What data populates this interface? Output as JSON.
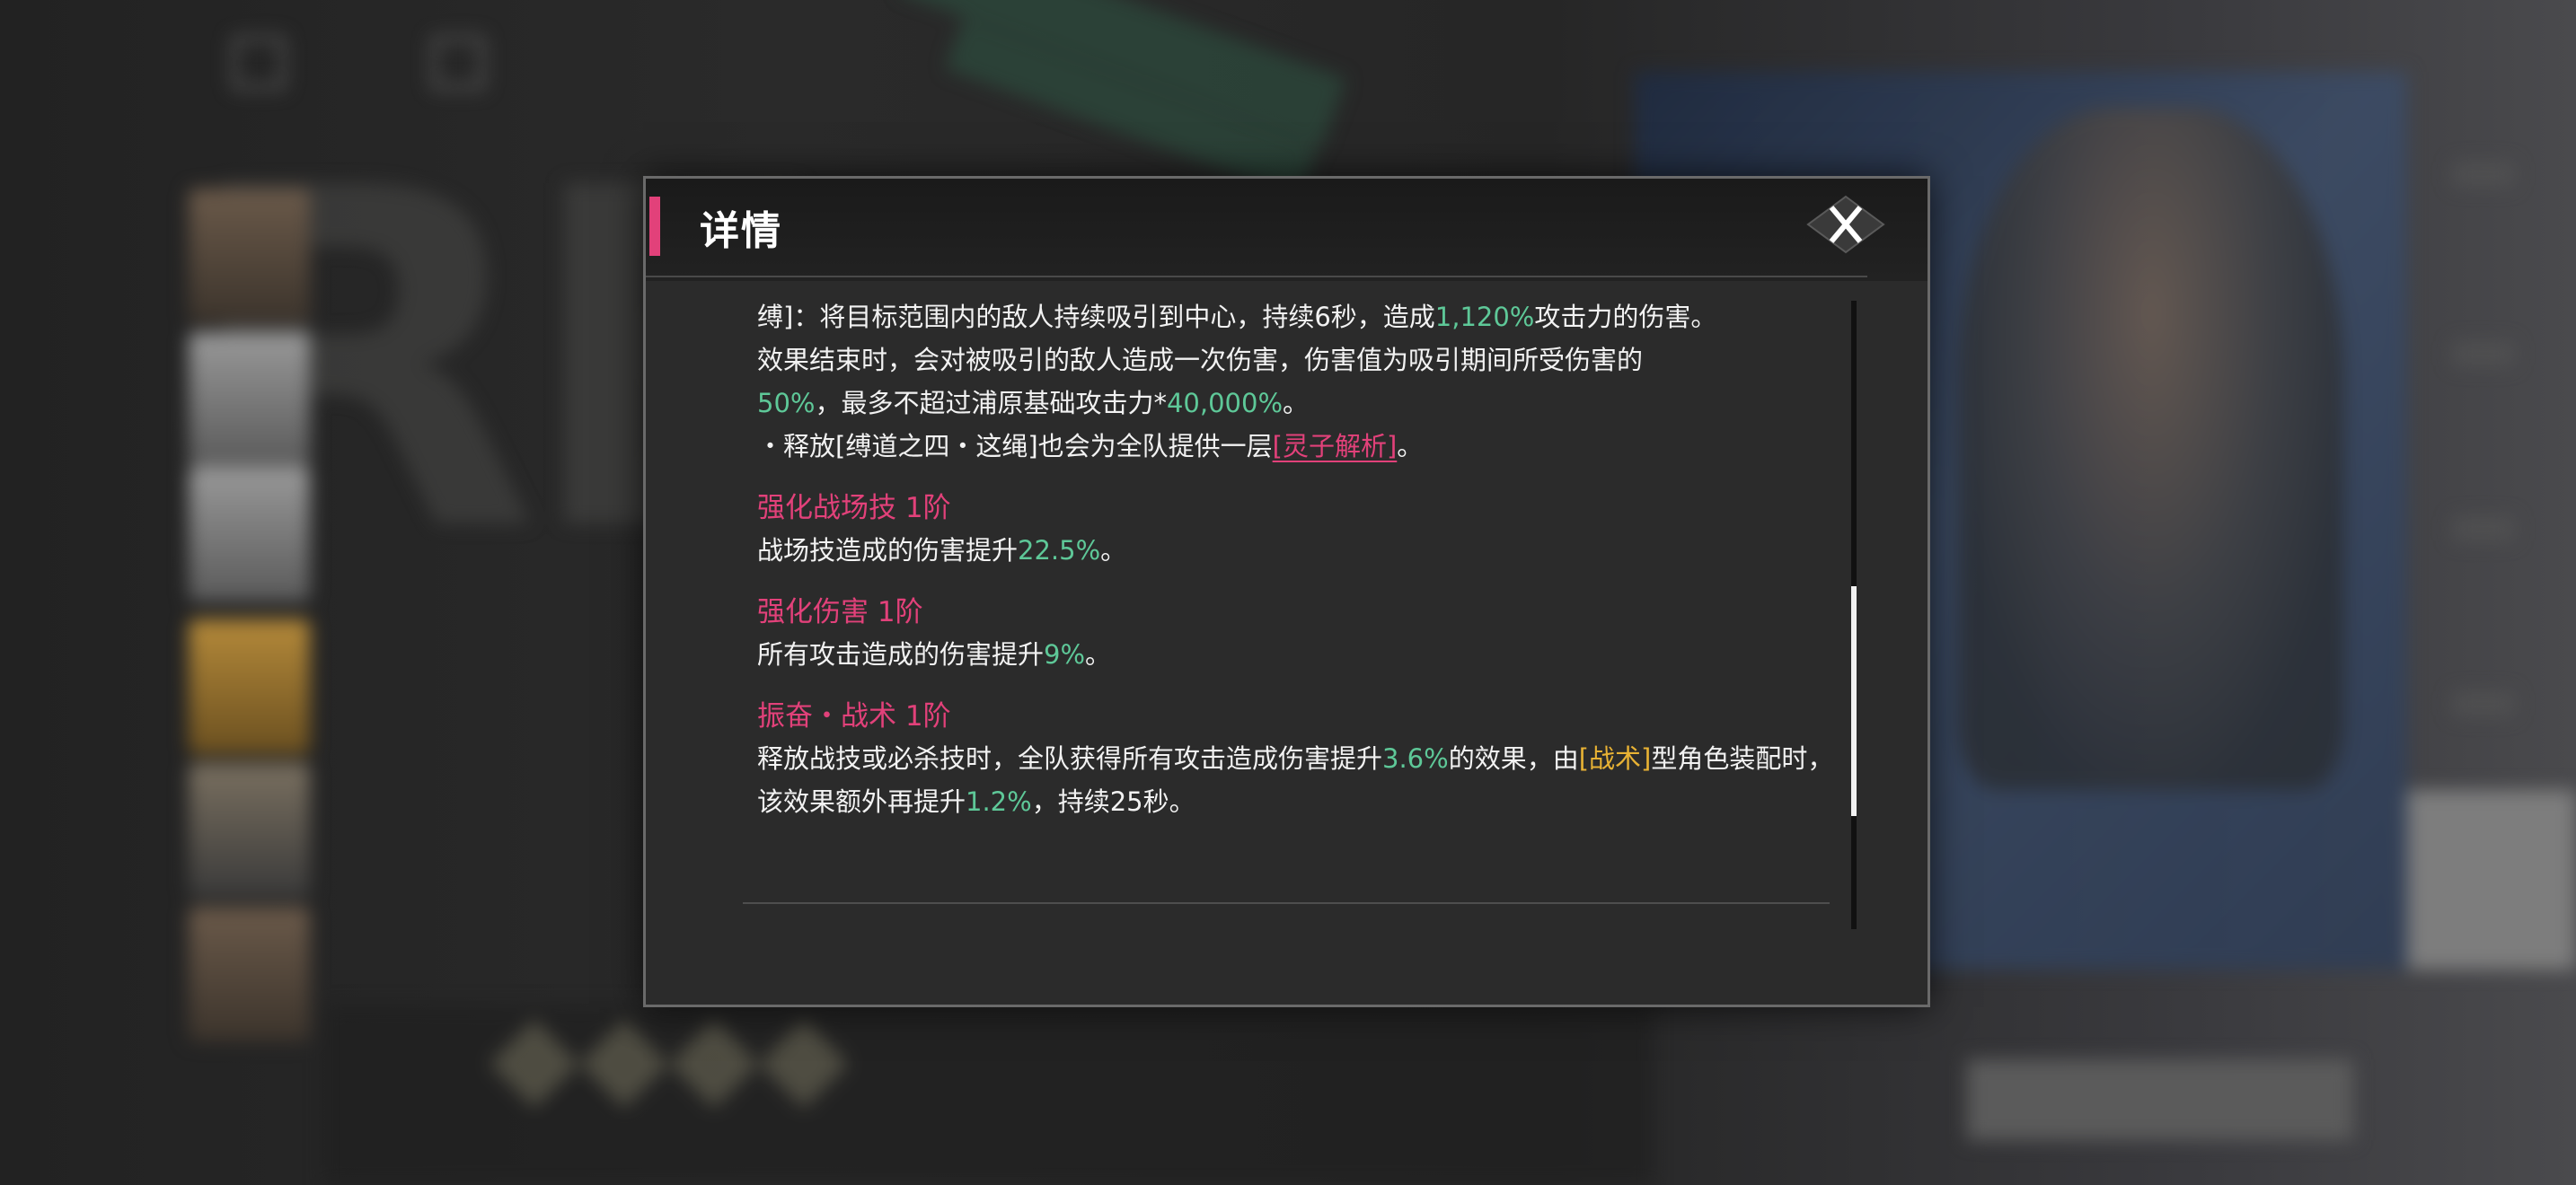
{
  "dialog": {
    "title": "详情",
    "close_icon": "close-x-icon",
    "accent_color": "#e2417a"
  },
  "content": {
    "intro": {
      "line1_pre": "缚]：将目标范围内的敌人持续吸引到中心，持续6秒，造成",
      "line1_value": "1,120%",
      "line1_post": "攻击力的伤害。",
      "line2": "效果结束时，会对被吸引的敌人造成一次伤害，伤害值为吸引期间所受伤害的",
      "line3_value1": "50%",
      "line3_mid": "，最多不超过浦原基础攻击力*",
      "line3_value2": "40,000%",
      "line3_post": "。",
      "line4_pre": "・释放[缚道之四・这绳]也会为全队提供一层",
      "line4_link": "[灵子解析]",
      "line4_post": "。"
    },
    "sections": [
      {
        "title": "强化战场技 1阶",
        "body_pre": "战场技造成的伤害提升",
        "body_value": "22.5%",
        "body_post": "。"
      },
      {
        "title": "强化伤害 1阶",
        "body_pre": "所有攻击造成的伤害提升",
        "body_value": "9%",
        "body_post": "。"
      },
      {
        "title": "振奋・战术 1阶",
        "body_pre": "释放战技或必杀技时，全队获得所有攻击造成伤害提升",
        "body_value": "3.6%",
        "body_mid": "的效果，由",
        "body_tag": "[战术]",
        "body_mid2": "型角色装配时，该效果额外再提升",
        "body_value2": "1.2%",
        "body_post": "，持续25秒。"
      }
    ]
  },
  "colors": {
    "value_green": "#5ec898",
    "tag_gold": "#e8b234",
    "heading_pink": "#e2417a"
  },
  "scrollbar": {
    "position_fraction": 0.45
  }
}
